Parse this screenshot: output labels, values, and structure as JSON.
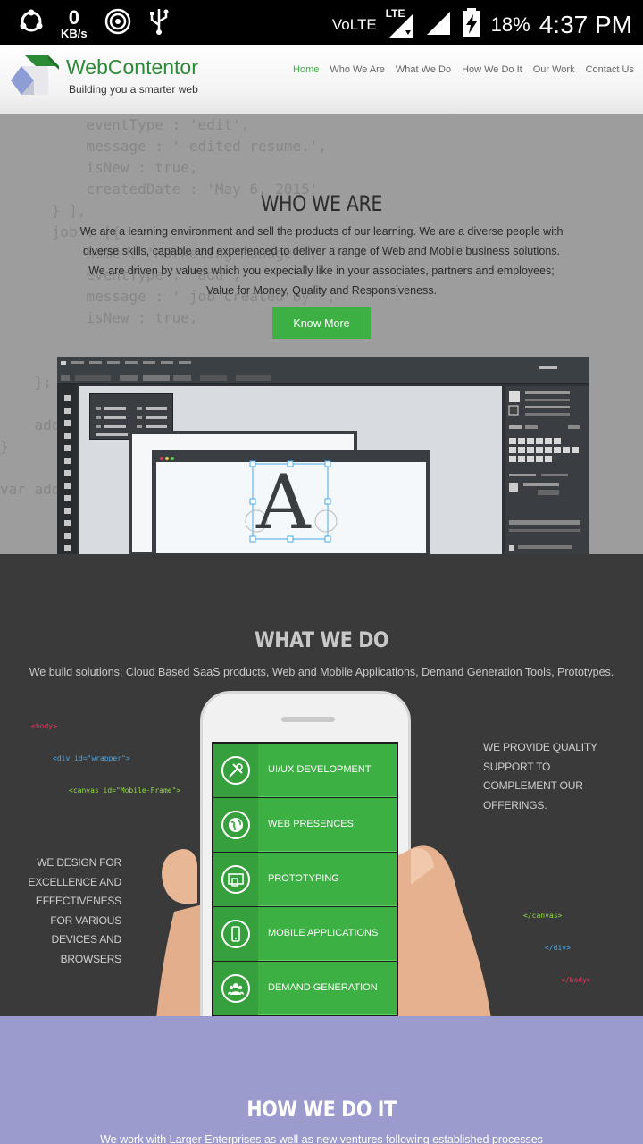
{
  "status_bar": {
    "kbs_value": "0",
    "kbs_unit": "KB/s",
    "network": "VoLTE",
    "lte": "LTE",
    "battery": "18%",
    "time": "4:37 PM",
    "icons": [
      "sync-icon",
      "hotspot-icon",
      "usb-icon",
      "signal-icon",
      "battery-charging-icon"
    ]
  },
  "header": {
    "brand": "WebContentor",
    "tagline": "Building you a smarter web",
    "nav": [
      {
        "label": "Home",
        "active": true
      },
      {
        "label": "Who We Are"
      },
      {
        "label": "What We Do"
      },
      {
        "label": "How We Do It"
      },
      {
        "label": "Our Work"
      },
      {
        "label": "Contact Us"
      }
    ]
  },
  "who_we_are": {
    "title": "WHO WE ARE",
    "text": "We are a learning environment and sell the products of our learning. We are a diverse people with diverse skills, capable and experienced to deliver a range of Web and Mobile business solutions. We are driven by values which you expecially like in your associates, partners and employees; Value for Money, Quality and Responsiveness.",
    "button": "Know More",
    "code_background": "          eventType : 'edit',\n          message : ' edited resume.',\n          isNew : true,\n          createdDate : 'May 6, 2015'\n      } ],\n      job : [{\n          name : 'Marketing Manager',\n          eventType : 'add',\n          message : ' job created by ',\n          isNew : true,\n\n\n    };\n\n    add\n}\n\nvar add",
    "app_letter": "A"
  },
  "what_we_do": {
    "title": "WHAT WE DO",
    "subtitle": "We build solutions; Cloud Based SaaS products, Web and Mobile Applications, Demand Generation Tools, Prototypes.",
    "code_top": [
      "<body>",
      "<div id=\"wrapper\">",
      "<canvas id=\"Mobile-Frame\">"
    ],
    "code_bottom": [
      "</canvas>",
      "</div>",
      "</body>"
    ],
    "right_text": "WE PROVIDE QUALITY SUPPORT TO COMPLEMENT OUR OFFERINGS.",
    "left_text": "WE DESIGN FOR EXCELLENCE AND EFFECTIVENESS FOR VARIOUS DEVICES AND BROWSERS",
    "services": [
      {
        "label": "UI/UX DEVELOPMENT",
        "icon": "tools-icon"
      },
      {
        "label": "WEB PRESENCES",
        "icon": "globe-icon"
      },
      {
        "label": "PROTOTYPING",
        "icon": "prototype-icon"
      },
      {
        "label": "MOBILE APPLICATIONS",
        "icon": "mobile-icon"
      },
      {
        "label": "DEMAND GENERATION",
        "icon": "users-icon"
      }
    ]
  },
  "how_we_do_it": {
    "title": "HOW WE DO IT",
    "text": "We work with Larger Enterprises as well as new ventures following established processes"
  },
  "colors": {
    "accent_green": "#3cb043",
    "dark_section": "#3a3a3a",
    "gray_section": "#9d9d9d",
    "purple_section": "#9b9bcd"
  }
}
